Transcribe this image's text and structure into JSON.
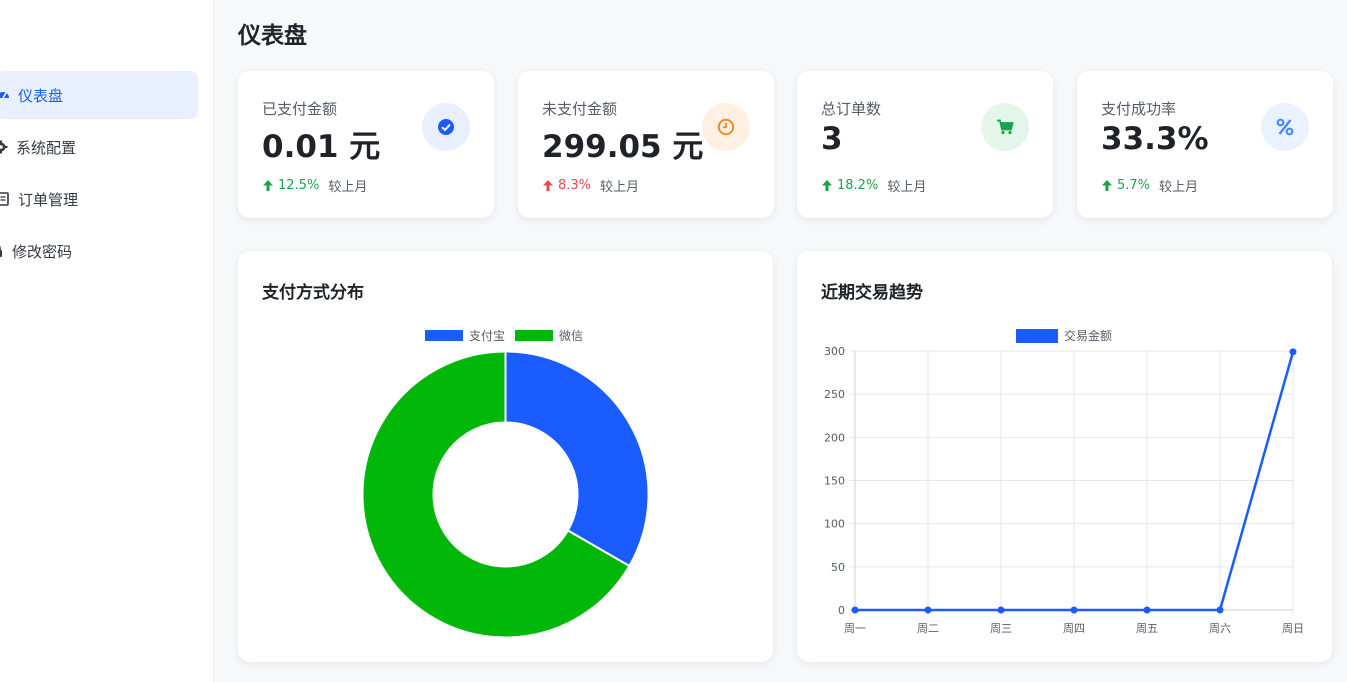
{
  "sidebar": {
    "items": [
      {
        "label": "仪表盘",
        "icon": "dashboard-icon",
        "active": true
      },
      {
        "label": "系统配置",
        "icon": "gear-icon",
        "active": false
      },
      {
        "label": "订单管理",
        "icon": "list-icon",
        "active": false
      },
      {
        "label": "修改密码",
        "icon": "lock-icon",
        "active": false
      }
    ]
  },
  "page": {
    "title": "仪表盘"
  },
  "stats": [
    {
      "label": "已支付金额",
      "value": "0.01 元",
      "change": "12.5%",
      "trend": "up",
      "compare": "较上月",
      "icon": "check-circle-icon",
      "icon_color": "#1a5cff",
      "icon_bg": "#e8efff"
    },
    {
      "label": "未支付金额",
      "value": "299.05 元",
      "change": "8.3%",
      "trend": "up",
      "compare": "较上月",
      "icon": "clock-icon",
      "icon_color": "#f08a24",
      "icon_bg": "#fff0e3"
    },
    {
      "label": "总订单数",
      "value": "3",
      "change": "18.2%",
      "trend": "up",
      "compare": "较上月",
      "icon": "cart-icon",
      "icon_color": "#1aa34a",
      "icon_bg": "#e4f6e9"
    },
    {
      "label": "支付成功率",
      "value": "33.3%",
      "change": "5.7%",
      "trend": "up",
      "compare": "较上月",
      "icon": "percent-icon",
      "icon_color": "#4a86ff",
      "icon_bg": "#eaf1ff"
    }
  ],
  "panels": {
    "payment_title": "支付方式分布",
    "trend_title": "近期交易趋势"
  },
  "colors": {
    "accent": "#1a5cff",
    "alipay": "#1a5cff",
    "wechat": "#00b70a",
    "up": "#1aa34a",
    "down": "#e5484d"
  },
  "chart_data": [
    {
      "type": "pie",
      "variant": "doughnut",
      "title": "",
      "categories": [
        "支付宝",
        "微信"
      ],
      "values": [
        1,
        2
      ],
      "colors": [
        "#1a5cff",
        "#00b70a"
      ],
      "legend": "top"
    },
    {
      "type": "line",
      "title": "",
      "categories": [
        "周一",
        "周二",
        "周三",
        "周四",
        "周五",
        "周六",
        "周日"
      ],
      "series": [
        {
          "name": "交易金额",
          "values": [
            0,
            0,
            0,
            0,
            0,
            0,
            299.05
          ],
          "color": "#1a5cff"
        }
      ],
      "yticks": [
        0,
        50,
        100,
        150,
        200,
        250,
        300
      ],
      "ylim": [
        0,
        300
      ],
      "grid": true,
      "legend": "top"
    }
  ]
}
